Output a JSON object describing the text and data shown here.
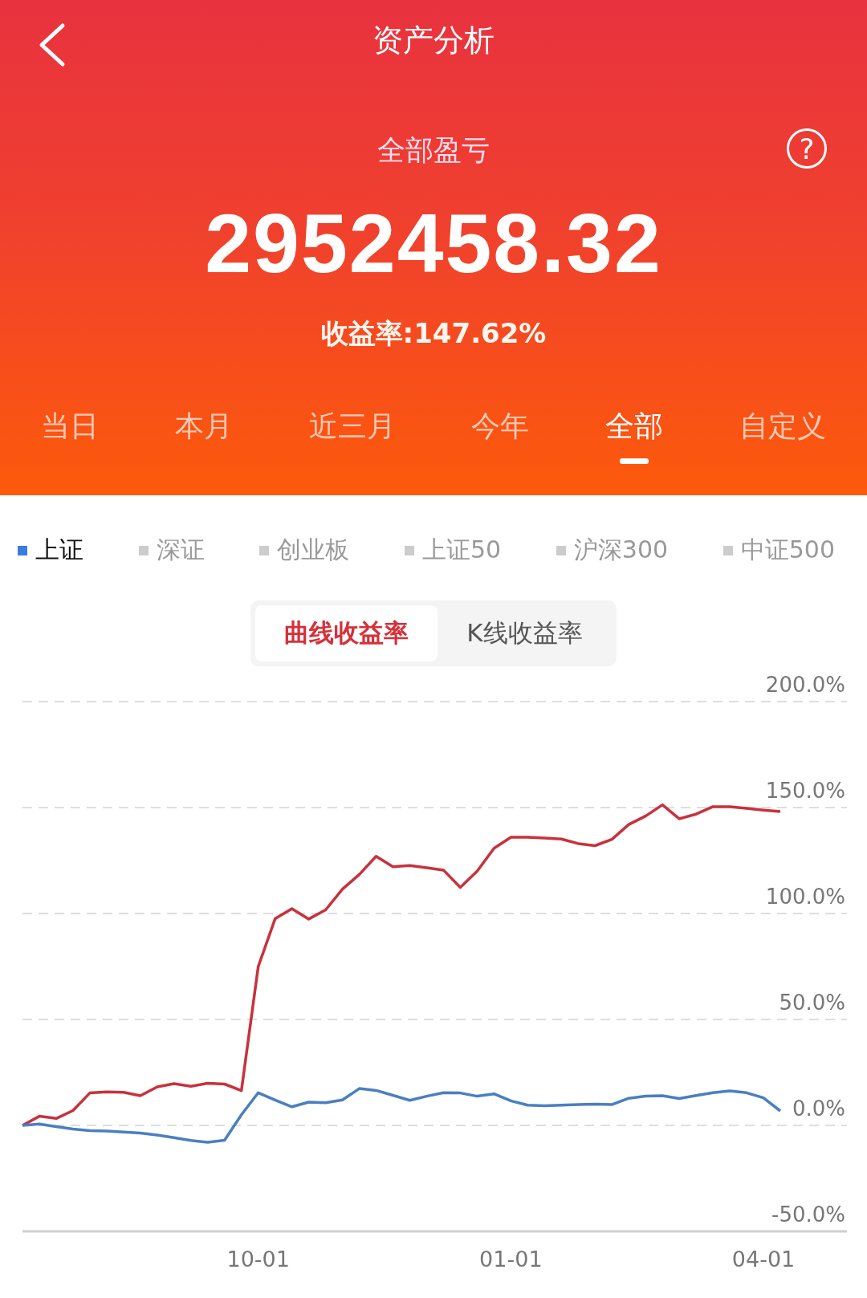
{
  "header": {
    "title": "资产分析"
  },
  "summary": {
    "label": "全部盈亏",
    "help": "?",
    "amount": "2952458.32",
    "rate": "收益率:147.62%"
  },
  "periods": [
    {
      "label": "当日",
      "selected": false
    },
    {
      "label": "本月",
      "selected": false
    },
    {
      "label": "近三月",
      "selected": false
    },
    {
      "label": "今年",
      "selected": false
    },
    {
      "label": "全部",
      "selected": true
    },
    {
      "label": "自定义",
      "selected": false
    }
  ],
  "indices": [
    {
      "label": "上证",
      "selected": true
    },
    {
      "label": "深证",
      "selected": false
    },
    {
      "label": "创业板",
      "selected": false
    },
    {
      "label": "上证50",
      "selected": false
    },
    {
      "label": "沪深300",
      "selected": false
    },
    {
      "label": "中证500",
      "selected": false
    }
  ],
  "view_modes": [
    {
      "label": "曲线收益率",
      "selected": true
    },
    {
      "label": "K线收益率",
      "selected": false
    }
  ],
  "chart": {
    "chart_data": {
      "type": "line",
      "grid": true,
      "categories": [
        null,
        null,
        null,
        null,
        null,
        null,
        null,
        null,
        null,
        null,
        null,
        null,
        null,
        null,
        "10-01",
        null,
        null,
        null,
        null,
        null,
        null,
        null,
        null,
        null,
        null,
        null,
        null,
        null,
        null,
        "01-01",
        null,
        null,
        null,
        null,
        null,
        null,
        null,
        null,
        null,
        null,
        null,
        null,
        null,
        null,
        "04-01",
        null
      ],
      "series": [
        {
          "color": "#c8323c",
          "values": [
            0,
            4.3,
            3.3,
            7,
            15.3,
            15.8,
            15.6,
            14,
            18.2,
            19.7,
            18.5,
            19.9,
            19.5,
            16.4,
            75,
            97.5,
            102.3,
            97.4,
            101.7,
            111.5,
            118.4,
            127,
            122.1,
            122.6,
            121.6,
            120.5,
            112.3,
            120,
            130.8,
            136,
            136,
            135.6,
            135.1,
            133,
            132,
            135,
            142,
            146,
            151.3,
            144.7,
            146.9,
            150.4,
            150.4,
            149.6,
            148.8,
            148.1
          ]
        },
        {
          "color": "#4a7fc1",
          "values": [
            0,
            0.7,
            -0.6,
            -1.7,
            -2.5,
            -2.7,
            -3.1,
            -3.6,
            -4.5,
            -5.8,
            -7.1,
            -8,
            -7,
            5,
            15.4,
            12,
            8.8,
            11,
            10.7,
            12,
            17.4,
            16.5,
            14.2,
            11.8,
            13.8,
            15.4,
            15.3,
            13.8,
            14.9,
            11.6,
            9.6,
            9.3,
            9.6,
            9.9,
            10,
            9.8,
            12.8,
            13.8,
            14,
            12.7,
            14.1,
            15.4,
            16.3,
            15.4,
            13,
            6.8
          ]
        }
      ],
      "ylim": [
        -50,
        200
      ],
      "yticks": [
        {
          "value": 200,
          "label": "200.0%"
        },
        {
          "value": 150,
          "label": "150.0%"
        },
        {
          "value": 100,
          "label": "100.0%"
        },
        {
          "value": 50,
          "label": "50.0%"
        },
        {
          "value": 0,
          "label": "0.0%"
        },
        {
          "value": -50,
          "label": "-50.0%"
        }
      ]
    }
  }
}
